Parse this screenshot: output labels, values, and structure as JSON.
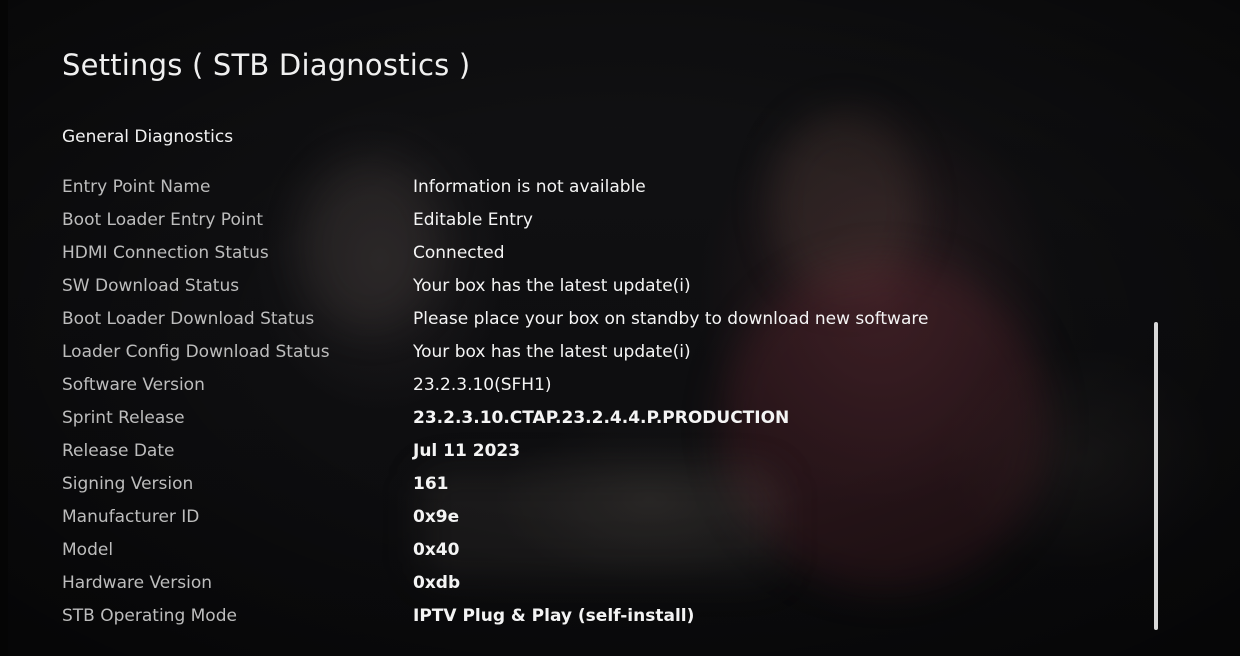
{
  "header": {
    "title": "Settings ( STB Diagnostics )"
  },
  "section": {
    "title": "General Diagnostics"
  },
  "rows": [
    {
      "label": "Entry Point Name",
      "value": "Information is not available"
    },
    {
      "label": "Boot Loader Entry Point",
      "value": "Editable Entry"
    },
    {
      "label": "HDMI Connection Status",
      "value": "Connected"
    },
    {
      "label": "SW Download Status",
      "value": "Your box has the latest update(i)"
    },
    {
      "label": "Boot Loader Download Status",
      "value": "Please place your box on standby to download new software"
    },
    {
      "label": "Loader Config Download Status",
      "value": "Your box has the latest update(i)"
    },
    {
      "label": "Software Version",
      "value": "23.2.3.10(SFH1)"
    },
    {
      "label": "Sprint Release",
      "value": "23.2.3.10.CTAP.23.2.4.4.P.PRODUCTION"
    },
    {
      "label": "Release Date",
      "value": "Jul 11 2023"
    },
    {
      "label": "Signing Version",
      "value": "161"
    },
    {
      "label": "Manufacturer ID",
      "value": "0x9e"
    },
    {
      "label": "Model",
      "value": "0x40"
    },
    {
      "label": "Hardware Version",
      "value": "0xdb"
    },
    {
      "label": "STB Operating Mode",
      "value": "IPTV Plug & Play (self-install)"
    }
  ],
  "colors": {
    "background": "#0f0f11",
    "label_text": "#bdbdbd",
    "value_text": "#f4f4f4",
    "scrollbar": "#d9d9d9"
  }
}
